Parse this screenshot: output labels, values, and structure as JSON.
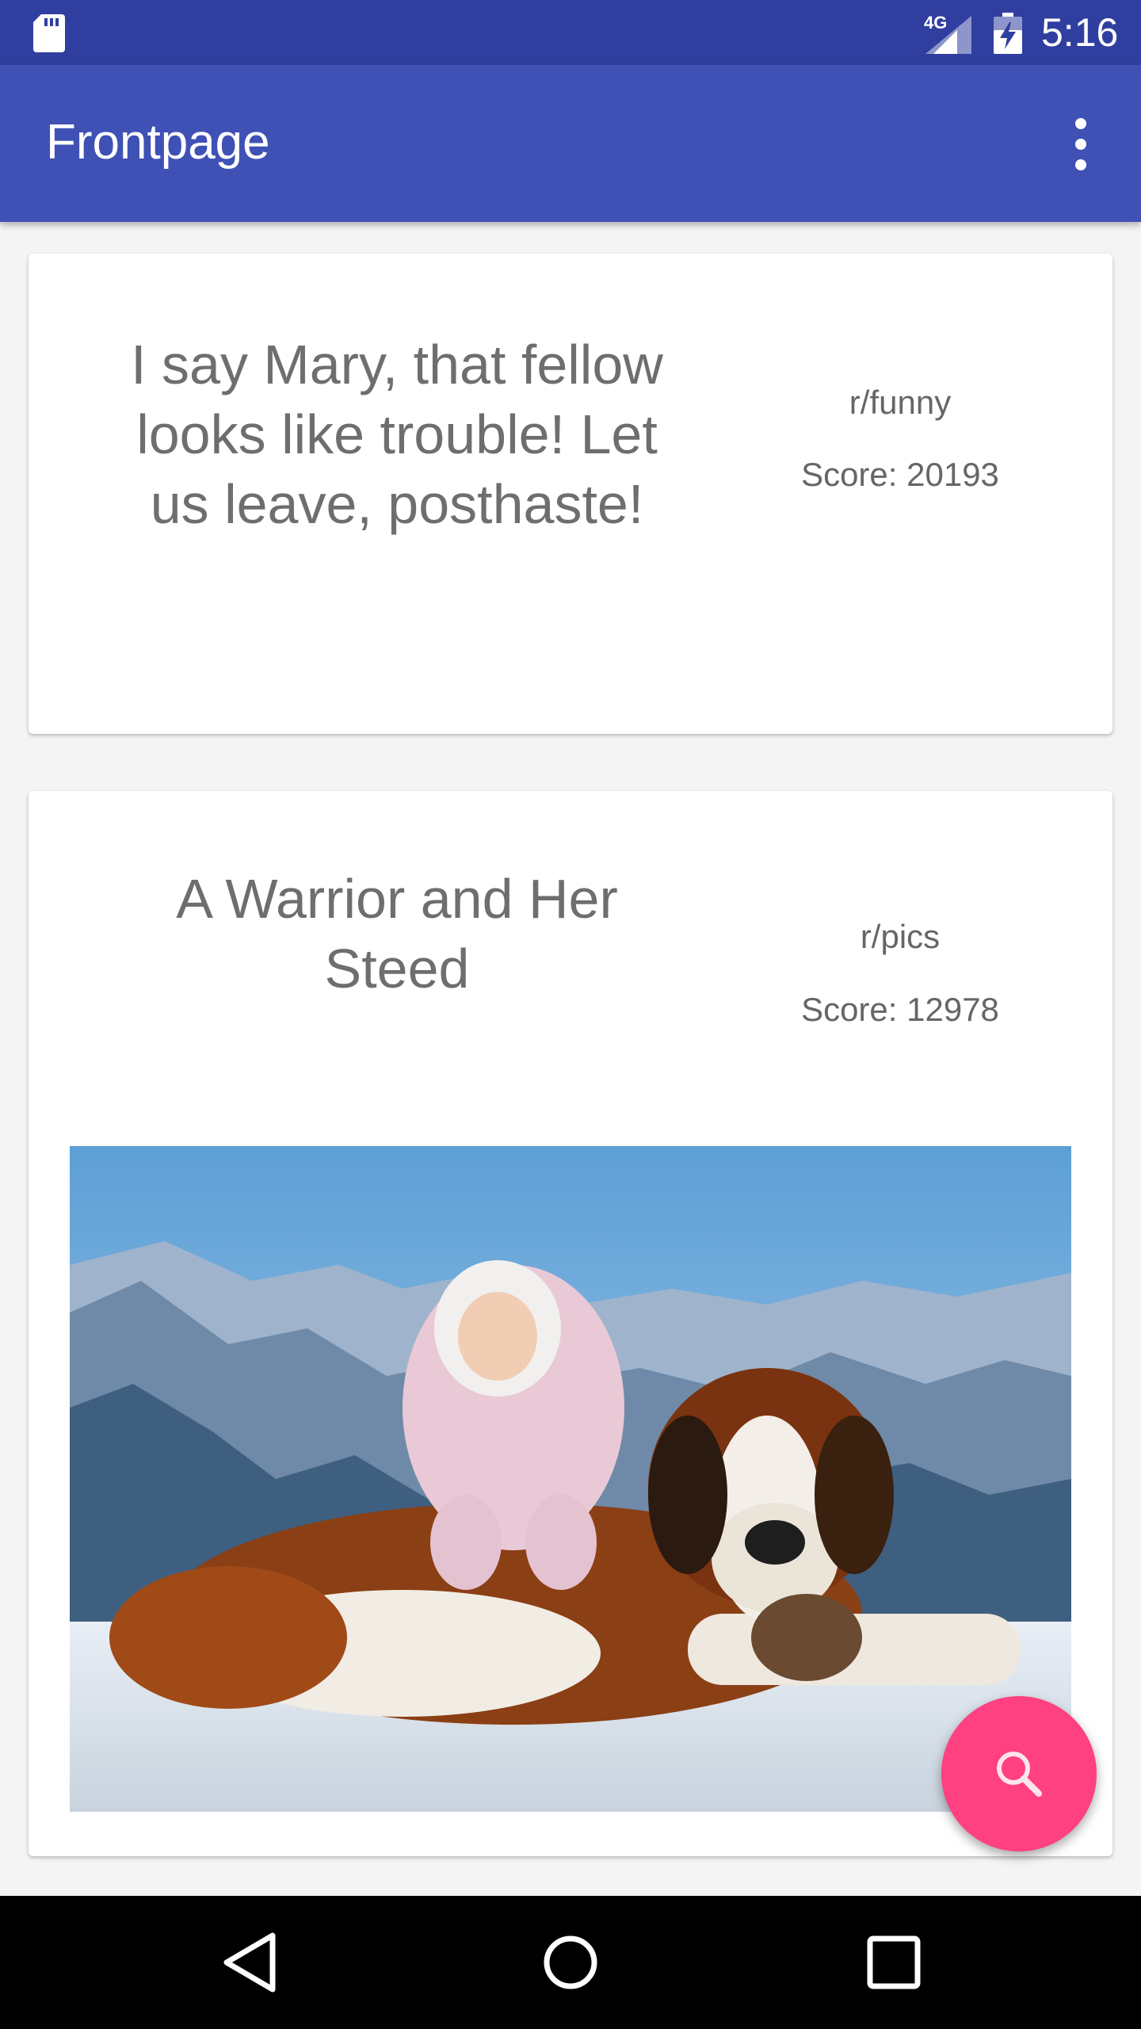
{
  "status_bar": {
    "network": "4G",
    "time": "5:16",
    "icons": [
      "sd-card-icon",
      "signal-icon",
      "battery-charging-icon"
    ]
  },
  "app_bar": {
    "title": "Frontpage",
    "menu_icon": "overflow-menu-icon"
  },
  "posts": [
    {
      "title": "I say Mary, that fellow looks like trouble! Let us leave, posthaste!",
      "subreddit": "r/funny",
      "score": "Score: 20193"
    },
    {
      "title": "A Warrior and Her Steed",
      "subreddit": "r/pics",
      "score": "Score: 12978",
      "image": "photo: baby in pink snowsuit sitting on a St. Bernard dog in snowy mountains"
    }
  ],
  "fab": {
    "icon": "search-icon",
    "color": "#ff4081"
  },
  "nav_bar": {
    "icons": [
      "back-icon",
      "home-icon",
      "recents-icon"
    ]
  },
  "colors": {
    "primary": "#3f51b5",
    "primary_dark": "#303f9f",
    "accent": "#ff4081"
  }
}
